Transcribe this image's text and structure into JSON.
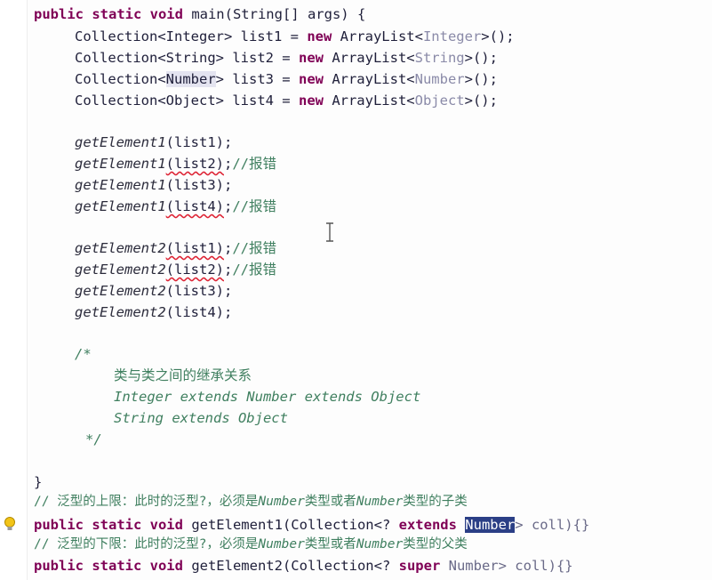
{
  "code": {
    "main_sig": {
      "kw": "public static void",
      "rest": " main(String[] args) {"
    },
    "decls": [
      {
        "type": "Collection<",
        "generic": "Integer",
        "tail": "> list1 = ",
        "kw": "new",
        "cls": " ArrayList<",
        "generic2": "Integer",
        "end": ">();"
      },
      {
        "type": "Collection<",
        "generic": "String",
        "tail": "> list2 = ",
        "kw": "new",
        "cls": " ArrayList<",
        "generic2": "String",
        "end": ">();"
      },
      {
        "type": "Collection<",
        "generic": "Number",
        "tail": "> list3 = ",
        "kw": "new",
        "cls": " ArrayList<",
        "generic2": "Number",
        "end": ">();"
      },
      {
        "type": "Collection<",
        "generic": "Object",
        "tail": "> list4 = ",
        "kw": "new",
        "cls": " ArrayList<",
        "generic2": "Object",
        "end": ">();"
      }
    ],
    "calls1": [
      {
        "method": "getElement1",
        "arg": "(list1)",
        "end": ";",
        "comment": ""
      },
      {
        "method": "getElement1",
        "arg": "(list2)",
        "end": ";",
        "comment": "//报错"
      },
      {
        "method": "getElement1",
        "arg": "(list3)",
        "end": ";",
        "comment": ""
      },
      {
        "method": "getElement1",
        "arg": "(list4)",
        "end": ";",
        "comment": "//报错"
      }
    ],
    "calls2": [
      {
        "method": "getElement2",
        "arg": "(list1)",
        "end": ";",
        "comment": "//报错"
      },
      {
        "method": "getElement2",
        "arg": "(list2)",
        "end": ";",
        "comment": "//报错"
      },
      {
        "method": "getElement2",
        "arg": "(list3)",
        "end": ";",
        "comment": ""
      },
      {
        "method": "getElement2",
        "arg": "(list4)",
        "end": ";",
        "comment": ""
      }
    ],
    "block_comment": {
      "open": "/*",
      "line1": "类与类之间的继承关系",
      "line2": "Integer extends Number extends Object",
      "line3": "String extends Object",
      "close": "*/"
    },
    "close_brace": "}",
    "comment_upper": {
      "a": "// 泛型的上限：此时的泛型?，必须是",
      "b": "Number",
      "c": "类型或者",
      "d": "Number",
      "e": "类型的子类"
    },
    "method1": {
      "kw": "public static void",
      "name": " getElement1(Collection<? ",
      "kw2": "extends",
      "space": " ",
      "hl": "Number",
      "rest": "> coll){}"
    },
    "comment_lower": {
      "a": "// 泛型的下限：此时的泛型?，必须是",
      "b": "Number",
      "c": "类型或者",
      "d": "Number",
      "e": "类型的父类"
    },
    "method2": {
      "kw": "public static void",
      "name": " getElement2(Collection<? ",
      "kw2": "super",
      "rest": " Number> coll){}"
    }
  },
  "icons": {
    "bulb": "lightbulb-icon",
    "cursor": "text-cursor-icon"
  }
}
